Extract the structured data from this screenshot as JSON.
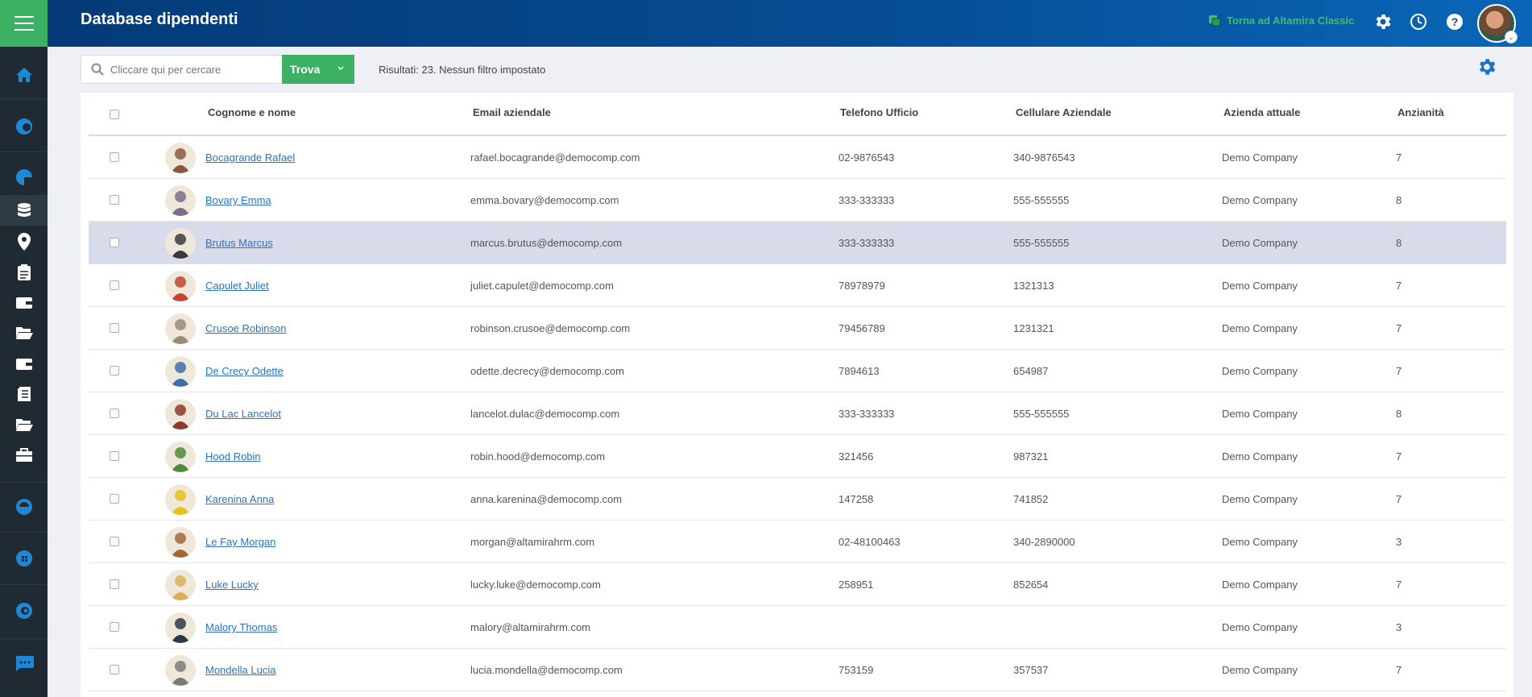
{
  "header": {
    "title": "Database dipendenti",
    "classic_link": "Torna ad Altamira Classic",
    "icons": [
      "settings-icon",
      "history-icon",
      "help-icon"
    ]
  },
  "sidebar": {
    "icons": [
      "menu-icon",
      "home-icon",
      "module-icon",
      "module-icon",
      "database-icon",
      "location-icon",
      "clipboard-icon",
      "wallet-icon",
      "folder-icon",
      "wallet-icon",
      "documents-icon",
      "folder-icon",
      "briefcase-icon",
      "module-icon",
      "module-icon",
      "module-icon",
      "chat-icon"
    ],
    "active": "database-icon"
  },
  "search": {
    "placeholder": "Cliccare qui per cercare",
    "button_label": "Trova",
    "results": "Risultati: 23. Nessun filtro impostato"
  },
  "table": {
    "columns": {
      "name": "Cognome e nome",
      "email": "Email aziendale",
      "phone": "Telefono Ufficio",
      "mobile": "Cellulare Aziendale",
      "company": "Azienda attuale",
      "seniority": "Anzianità"
    },
    "rows": [
      {
        "name": "Bocagrande Rafael",
        "email": "rafael.bocagrande@democomp.com",
        "phone": "02-9876543",
        "mobile": "340-9876543",
        "company": "Demo Company",
        "seniority": "7",
        "color": "#8a5a3a"
      },
      {
        "name": "Bovary Emma",
        "email": "emma.bovary@democomp.com",
        "phone": "333-333333",
        "mobile": "555-555555",
        "company": "Demo Company",
        "seniority": "8",
        "color": "#7a6f8a"
      },
      {
        "name": "Brutus Marcus",
        "email": "marcus.brutus@democomp.com",
        "phone": "333-333333",
        "mobile": "555-555555",
        "company": "Demo Company",
        "seniority": "8",
        "color": "#3a3a3a"
      },
      {
        "name": "Capulet Juliet",
        "email": "juliet.capulet@democomp.com",
        "phone": "78978979",
        "mobile": "1321313",
        "company": "Demo Company",
        "seniority": "7",
        "color": "#c0452e"
      },
      {
        "name": "Crusoe Robinson",
        "email": "robinson.crusoe@democomp.com",
        "phone": "79456789",
        "mobile": "1231321",
        "company": "Demo Company",
        "seniority": "7",
        "color": "#9b8a74"
      },
      {
        "name": "De Crecy Odette",
        "email": "odette.decrecy@democomp.com",
        "phone": "7894613",
        "mobile": "654987",
        "company": "Demo Company",
        "seniority": "7",
        "color": "#3f6fa8"
      },
      {
        "name": "Du Lac Lancelot",
        "email": "lancelot.dulac@democomp.com",
        "phone": "333-333333",
        "mobile": "555-555555",
        "company": "Demo Company",
        "seniority": "8",
        "color": "#8e3a2a"
      },
      {
        "name": "Hood Robin",
        "email": "robin.hood@democomp.com",
        "phone": "321456",
        "mobile": "987321",
        "company": "Demo Company",
        "seniority": "7",
        "color": "#4e8a3a"
      },
      {
        "name": "Karenina Anna",
        "email": "anna.karenina@democomp.com",
        "phone": "147258",
        "mobile": "741852",
        "company": "Demo Company",
        "seniority": "7",
        "color": "#e6c21f"
      },
      {
        "name": "Le Fay Morgan",
        "email": "morgan@altamirahrm.com",
        "phone": "02-48100463",
        "mobile": "340-2890000",
        "company": "Demo Company",
        "seniority": "3",
        "color": "#a5673a"
      },
      {
        "name": "Luke Lucky",
        "email": "lucky.luke@democomp.com",
        "phone": "258951",
        "mobile": "852654",
        "company": "Demo Company",
        "seniority": "7",
        "color": "#d8b25a"
      },
      {
        "name": "Malory Thomas",
        "email": "malory@altamirahrm.com",
        "phone": "",
        "mobile": "",
        "company": "Demo Company",
        "seniority": "3",
        "color": "#2a3a4a"
      },
      {
        "name": "Mondella Lucia",
        "email": "lucia.mondella@democomp.com",
        "phone": "753159",
        "mobile": "357537",
        "company": "Demo Company",
        "seniority": "7",
        "color": "#7a7a7a"
      }
    ],
    "highlighted_row": 2
  },
  "colors": {
    "accent_green": "#3cb063",
    "header_blue": "#064c93",
    "sidebar_dark": "#1f2a33",
    "link_blue": "#2a73c4",
    "icon_blue": "#1f88d6"
  }
}
